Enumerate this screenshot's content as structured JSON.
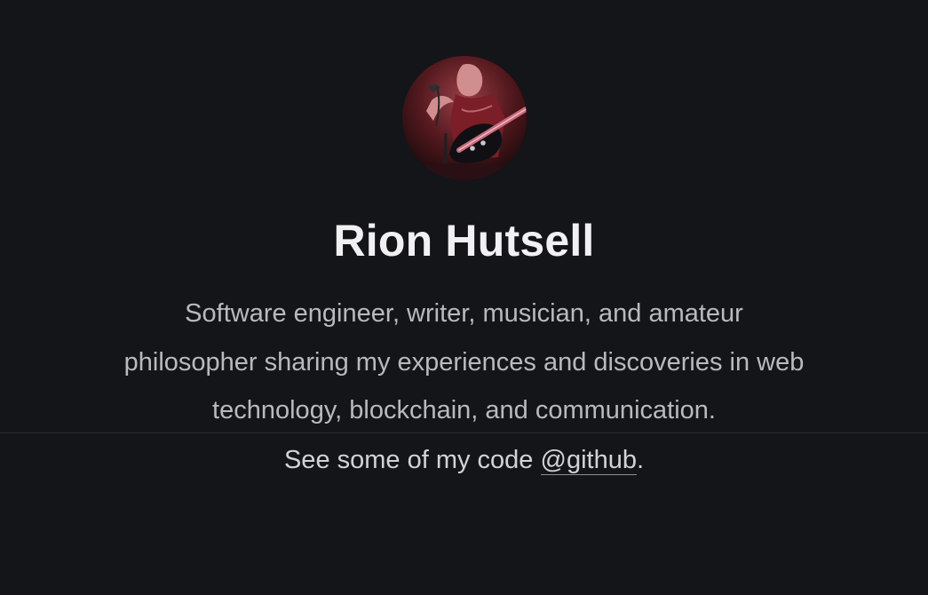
{
  "profile": {
    "avatar_label": "",
    "name": "Rion Hutsell",
    "bio": "Software engineer, writer, musician, and amateur philosopher sharing my experiences and discoveries in web technology, blockchain, and communication.",
    "code_prefix": "See some of my code ",
    "github_link": "@github",
    "code_suffix": "."
  },
  "colors": {
    "background": "#141518",
    "name_text": "#f1f1f3",
    "bio_text": "#b9babd",
    "divider": "#2a2c30",
    "avatar_tone": "#8b2630"
  },
  "icons": {
    "avatar": "profile-photo"
  }
}
